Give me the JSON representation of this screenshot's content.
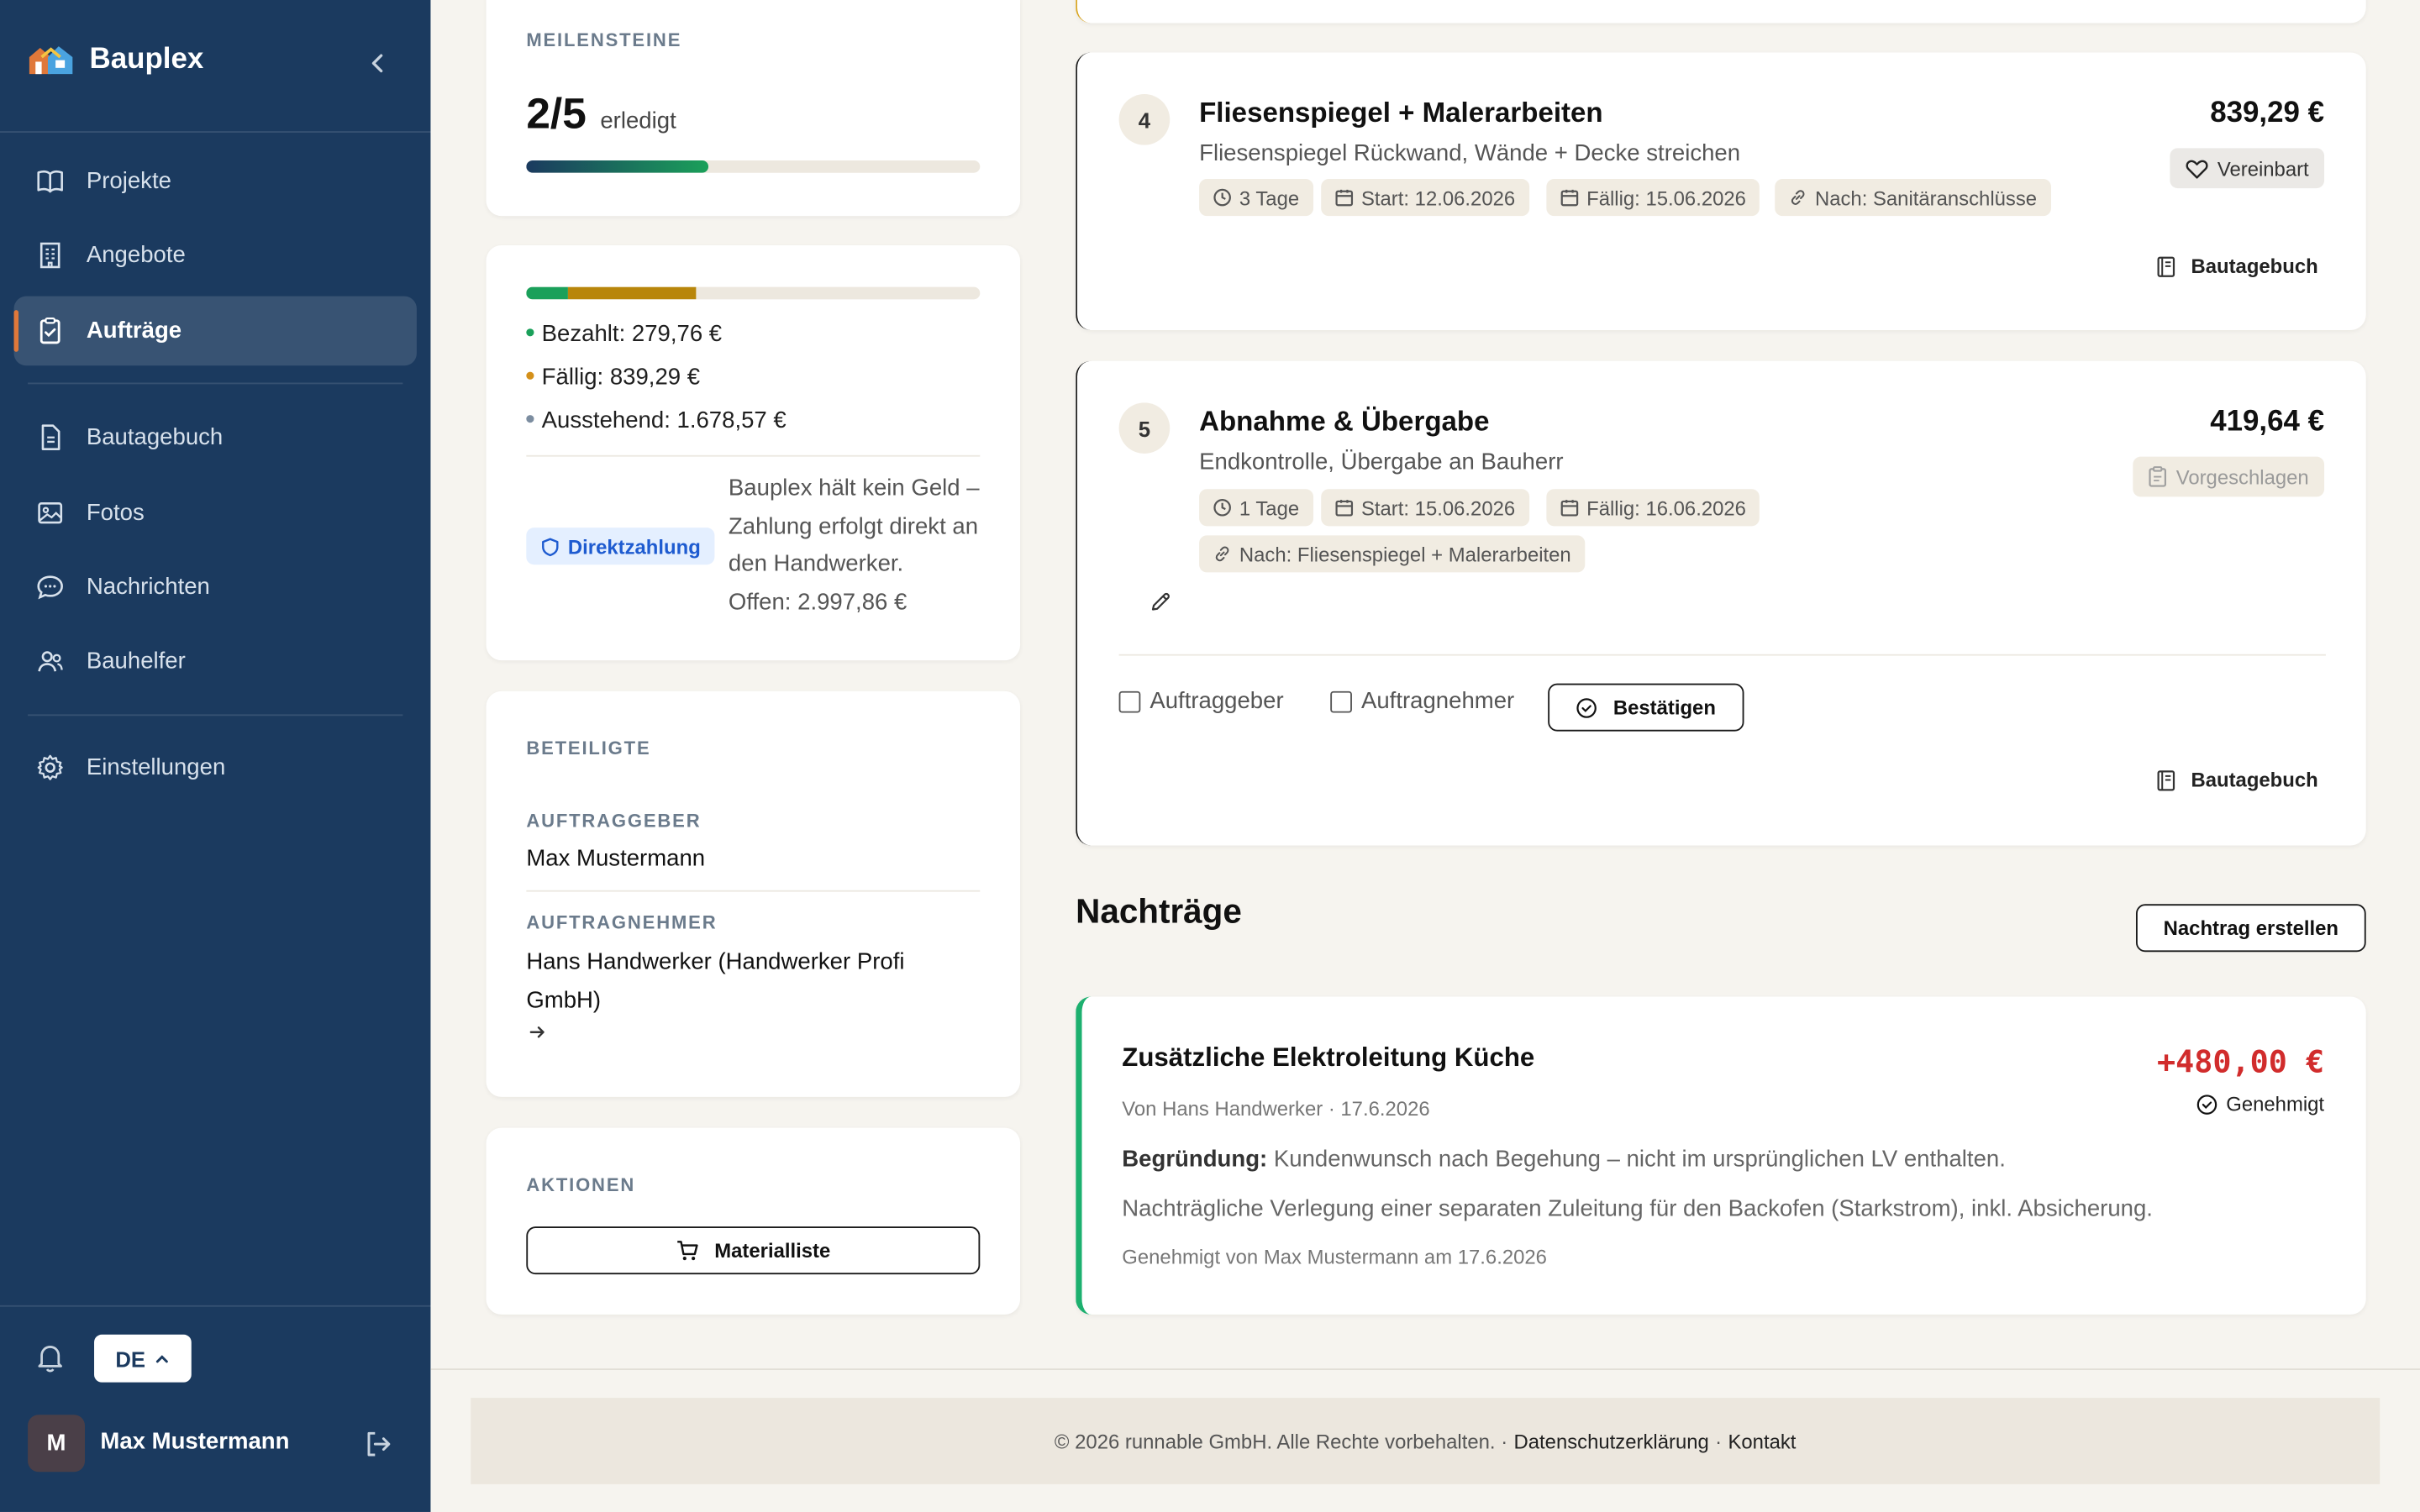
{
  "app": {
    "name": "Bauplex"
  },
  "nav": {
    "items": [
      {
        "label": "Projekte",
        "icon": "book-icon"
      },
      {
        "label": "Angebote",
        "icon": "building-icon"
      },
      {
        "label": "Aufträge",
        "icon": "clipboard-check-icon",
        "active": true
      },
      {
        "label": "Bautagebuch",
        "icon": "document-icon"
      },
      {
        "label": "Fotos",
        "icon": "image-icon"
      },
      {
        "label": "Nachrichten",
        "icon": "chat-icon"
      },
      {
        "label": "Bauhelfer",
        "icon": "users-icon"
      },
      {
        "label": "Einstellungen",
        "icon": "gear-icon"
      }
    ]
  },
  "lang": "DE",
  "user": {
    "initial": "M",
    "name": "Max Mustermann"
  },
  "milestones_summary": {
    "label": "MEILENSTEINE",
    "count": "2/5",
    "count_suffix": "erledigt",
    "progress_fraction": 0.4
  },
  "payments": {
    "bezahlt": "Bezahlt: 279,76 €",
    "faellig": "Fällig: 839,29 €",
    "ausstehend": "Ausstehend: 1.678,57 €",
    "bar_fractions": {
      "paid": 0.0933,
      "due": 0.28
    },
    "badge": "Direktzahlung",
    "note": "Bauplex hält kein Geld – Zahlung erfolgt direkt an den Handwerker.",
    "offen": "Offen: 2.997,86 €",
    "colors": {
      "paid": "#1aa05a",
      "due": "#b8860b",
      "pending": "#7c8da0"
    }
  },
  "participants": {
    "label": "BETEILIGTE",
    "client_label": "AUFTRAGGEBER",
    "client_name": "Max Mustermann",
    "contractor_label": "AUFTRAGNEHMER",
    "contractor_name": "Hans Handwerker (Handwerker Profi GmbH)"
  },
  "actions": {
    "label": "AKTIONEN",
    "material_button": "Materialliste"
  },
  "milestones": [
    {
      "number": "4",
      "title": "Fliesenspiegel + Malerarbeiten",
      "description": "Fliesenspiegel Rückwand, Wände + Decke streichen",
      "duration": "3 Tage",
      "start": "Start: 12.06.2026",
      "due": "Fällig: 15.06.2026",
      "after": "Nach: Sanitäranschlüsse",
      "price": "839,29 €",
      "status": "Vereinbart",
      "diary": "Bautagebuch"
    },
    {
      "number": "5",
      "title": "Abnahme & Übergabe",
      "description": "Endkontrolle, Übergabe an Bauherr",
      "duration": "1 Tage",
      "start": "Start: 15.06.2026",
      "due": "Fällig: 16.06.2026",
      "after": "Nach: Fliesenspiegel + Malerarbeiten",
      "price": "419,64 €",
      "status": "Vorgeschlagen",
      "check_client": "Auftraggeber",
      "check_contractor": "Auftragnehmer",
      "confirm": "Bestätigen",
      "diary": "Bautagebuch"
    }
  ],
  "change_orders": {
    "heading": "Nachträge",
    "create_button": "Nachtrag erstellen",
    "items": [
      {
        "title": "Zusätzliche Elektroleitung Küche",
        "meta": "Von Hans Handwerker · 17.6.2026",
        "amount": "+480,00 €",
        "status": "Genehmigt",
        "reason_label": "Begründung:",
        "reason": "Kundenwunsch nach Begehung – nicht im ursprünglichen LV enthalten.",
        "detail": "Nachträgliche Verlegung einer separaten Zuleitung für den Backofen (Starkstrom), inkl. Absicherung.",
        "approved": "Genehmigt von Max Mustermann am 17.6.2026",
        "amount_color": "#d12c2c",
        "accent_color": "#1db06f"
      }
    ]
  },
  "footer": {
    "copyright": "© 2026 runnable GmbH. Alle Rechte vorbehalten. ·",
    "privacy": "Datenschutzerklärung",
    "sep": "·",
    "contact": "Kontakt"
  }
}
